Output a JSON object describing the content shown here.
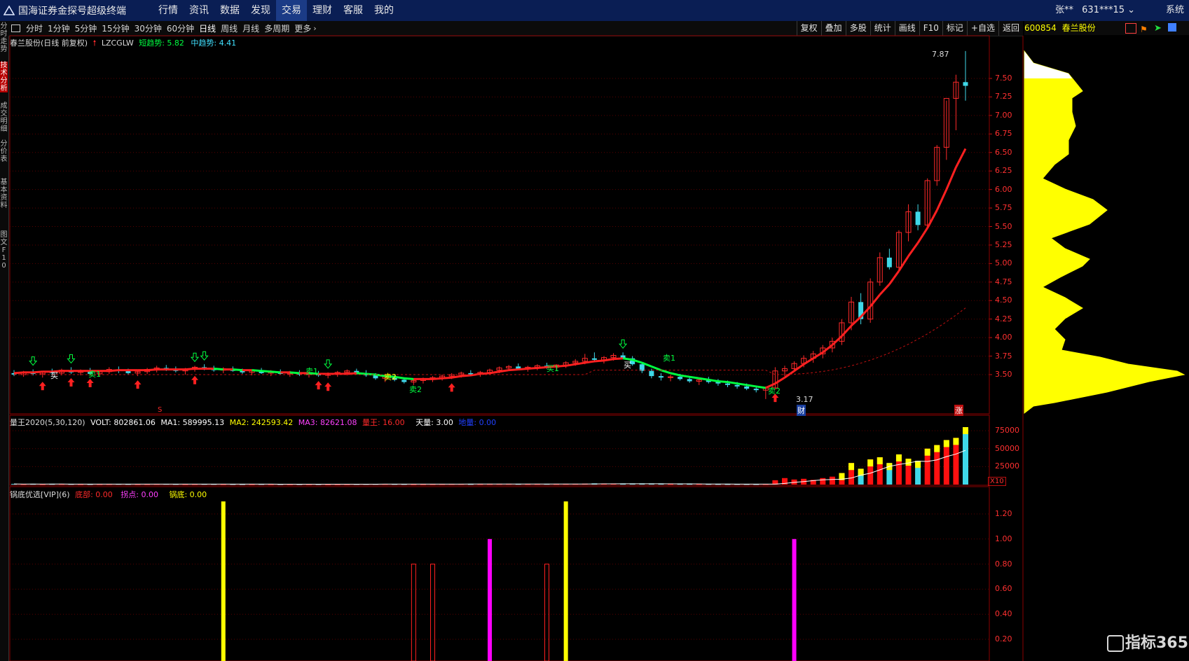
{
  "app": {
    "title": "国海证券金探号超级终端"
  },
  "menu": [
    "行情",
    "资讯",
    "数据",
    "发现",
    "交易",
    "理财",
    "客服",
    "我的"
  ],
  "menu_active": 4,
  "user": {
    "name": "张**",
    "account": "631***15"
  },
  "system_label": "系统",
  "periods": [
    "分时",
    "1分钟",
    "5分钟",
    "15分钟",
    "30分钟",
    "60分钟",
    "日线",
    "周线",
    "月线",
    "多周期",
    "更多"
  ],
  "period_active": 6,
  "right_buttons": [
    "复权",
    "叠加",
    "多股",
    "统计",
    "画线",
    "F10",
    "标记",
    "+自选",
    "返回"
  ],
  "left_tabs": [
    "分时走势",
    "技术分析",
    "成交明细",
    "分价表",
    "基本资料",
    "图文F10"
  ],
  "main_header": {
    "stock": "春兰股份(日线 前复权)",
    "indicator": "LZCGLW",
    "short_label": "短趋势",
    "short_val": "5.82",
    "mid_label": "中趋势",
    "mid_val": "4.41"
  },
  "annotations": {
    "high": "7.87",
    "low": "3.17",
    "cai": "财",
    "zhang": "涨",
    "s_mark": "S",
    "buy": "买",
    "sell1": "卖1",
    "sell2": "卖2",
    "buy1": "买1"
  },
  "price_axis": [
    "7.50",
    "7.25",
    "7.00",
    "6.75",
    "6.50",
    "6.25",
    "6.00",
    "5.75",
    "5.50",
    "5.25",
    "5.00",
    "4.75",
    "4.50",
    "4.25",
    "4.00",
    "3.75",
    "3.50"
  ],
  "vol_header": {
    "name": "量王2020(5,30,120)",
    "volt": "VOLT: 802861.06",
    "ma1": "MA1: 589995.13",
    "ma2": "MA2: 242593.42",
    "ma3": "MA3: 82621.08",
    "lw": "量王: 16.00",
    "tl": "天量: 3.00",
    "ll": "地量: 0.00"
  },
  "vol_axis": [
    "75000",
    "50000",
    "25000"
  ],
  "vol_unit": "X10",
  "ind_header": {
    "name": "锅底优选[VIP](6)",
    "db": "底部: 0.00",
    "gd": "拐点: 0.00",
    "gdi": "锅底: 0.00"
  },
  "ind_axis": [
    "1.20",
    "1.00",
    "0.80",
    "0.60",
    "0.40",
    "0.20"
  ],
  "right_panel": {
    "code": "600854",
    "name": "春兰股份"
  },
  "watermark": "指标365",
  "colors": {
    "up": "#ff2a2a",
    "down": "#3fd8e8",
    "short_trend": "#00ff40",
    "yellow": "#ffff00",
    "magenta": "#ff00ff",
    "axis": "#c01010"
  },
  "chart_data": [
    {
      "type": "candlestick",
      "title": "春兰股份(日线 前复权)",
      "ylim": [
        3.2,
        7.9
      ],
      "candles": [
        [
          3.52,
          3.56,
          3.48,
          3.5
        ],
        [
          3.5,
          3.55,
          3.47,
          3.53
        ],
        [
          3.53,
          3.57,
          3.49,
          3.51
        ],
        [
          3.51,
          3.55,
          3.46,
          3.54
        ],
        [
          3.54,
          3.58,
          3.5,
          3.52
        ],
        [
          3.52,
          3.58,
          3.49,
          3.56
        ],
        [
          3.56,
          3.6,
          3.51,
          3.53
        ],
        [
          3.53,
          3.57,
          3.49,
          3.55
        ],
        [
          3.55,
          3.59,
          3.5,
          3.51
        ],
        [
          3.51,
          3.56,
          3.48,
          3.54
        ],
        [
          3.54,
          3.6,
          3.51,
          3.57
        ],
        [
          3.57,
          3.61,
          3.52,
          3.55
        ],
        [
          3.55,
          3.58,
          3.5,
          3.52
        ],
        [
          3.52,
          3.56,
          3.48,
          3.54
        ],
        [
          3.54,
          3.59,
          3.51,
          3.57
        ],
        [
          3.57,
          3.62,
          3.53,
          3.59
        ],
        [
          3.59,
          3.63,
          3.55,
          3.58
        ],
        [
          3.58,
          3.61,
          3.53,
          3.55
        ],
        [
          3.55,
          3.59,
          3.5,
          3.57
        ],
        [
          3.57,
          3.62,
          3.54,
          3.6
        ],
        [
          3.6,
          3.64,
          3.56,
          3.58
        ],
        [
          3.58,
          3.62,
          3.54,
          3.56
        ],
        [
          3.56,
          3.6,
          3.52,
          3.58
        ],
        [
          3.58,
          3.61,
          3.54,
          3.55
        ],
        [
          3.55,
          3.58,
          3.51,
          3.53
        ],
        [
          3.53,
          3.57,
          3.49,
          3.55
        ],
        [
          3.55,
          3.59,
          3.51,
          3.52
        ],
        [
          3.52,
          3.56,
          3.48,
          3.54
        ],
        [
          3.54,
          3.57,
          3.5,
          3.51
        ],
        [
          3.51,
          3.55,
          3.47,
          3.53
        ],
        [
          3.53,
          3.56,
          3.48,
          3.5
        ],
        [
          3.5,
          3.54,
          3.46,
          3.52
        ],
        [
          3.52,
          3.55,
          3.47,
          3.49
        ],
        [
          3.49,
          3.53,
          3.45,
          3.51
        ],
        [
          3.51,
          3.55,
          3.47,
          3.53
        ],
        [
          3.53,
          3.57,
          3.49,
          3.55
        ],
        [
          3.55,
          3.58,
          3.5,
          3.52
        ],
        [
          3.52,
          3.56,
          3.47,
          3.49
        ],
        [
          3.49,
          3.52,
          3.43,
          3.45
        ],
        [
          3.45,
          3.49,
          3.4,
          3.47
        ],
        [
          3.47,
          3.5,
          3.41,
          3.43
        ],
        [
          3.43,
          3.46,
          3.38,
          3.4
        ],
        [
          3.4,
          3.44,
          3.36,
          3.42
        ],
        [
          3.42,
          3.46,
          3.38,
          3.44
        ],
        [
          3.44,
          3.48,
          3.4,
          3.46
        ],
        [
          3.46,
          3.5,
          3.42,
          3.48
        ],
        [
          3.48,
          3.52,
          3.44,
          3.5
        ],
        [
          3.5,
          3.54,
          3.46,
          3.52
        ],
        [
          3.52,
          3.56,
          3.48,
          3.5
        ],
        [
          3.5,
          3.55,
          3.47,
          3.53
        ],
        [
          3.53,
          3.58,
          3.5,
          3.56
        ],
        [
          3.56,
          3.61,
          3.52,
          3.59
        ],
        [
          3.59,
          3.63,
          3.55,
          3.61
        ],
        [
          3.61,
          3.65,
          3.57,
          3.58
        ],
        [
          3.58,
          3.62,
          3.54,
          3.6
        ],
        [
          3.6,
          3.64,
          3.56,
          3.62
        ],
        [
          3.62,
          3.66,
          3.58,
          3.6
        ],
        [
          3.6,
          3.64,
          3.56,
          3.63
        ],
        [
          3.63,
          3.68,
          3.59,
          3.66
        ],
        [
          3.66,
          3.71,
          3.62,
          3.68
        ],
        [
          3.68,
          3.78,
          3.64,
          3.72
        ],
        [
          3.72,
          3.8,
          3.67,
          3.7
        ],
        [
          3.7,
          3.75,
          3.65,
          3.73
        ],
        [
          3.73,
          3.79,
          3.69,
          3.76
        ],
        [
          3.76,
          3.8,
          3.71,
          3.72
        ],
        [
          3.72,
          3.75,
          3.62,
          3.64
        ],
        [
          3.64,
          3.66,
          3.52,
          3.55
        ],
        [
          3.55,
          3.58,
          3.45,
          3.48
        ],
        [
          3.48,
          3.52,
          3.42,
          3.46
        ],
        [
          3.46,
          3.5,
          3.41,
          3.47
        ],
        [
          3.47,
          3.51,
          3.42,
          3.44
        ],
        [
          3.44,
          3.48,
          3.39,
          3.41
        ],
        [
          3.41,
          3.45,
          3.36,
          3.43
        ],
        [
          3.43,
          3.47,
          3.38,
          3.4
        ],
        [
          3.4,
          3.44,
          3.35,
          3.38
        ],
        [
          3.38,
          3.42,
          3.33,
          3.36
        ],
        [
          3.36,
          3.4,
          3.31,
          3.34
        ],
        [
          3.34,
          3.38,
          3.29,
          3.31
        ],
        [
          3.31,
          3.35,
          3.26,
          3.29
        ],
        [
          3.29,
          3.34,
          3.17,
          3.32
        ],
        [
          3.32,
          3.6,
          3.3,
          3.55
        ],
        [
          3.55,
          3.62,
          3.48,
          3.58
        ],
        [
          3.58,
          3.68,
          3.54,
          3.65
        ],
        [
          3.65,
          3.76,
          3.6,
          3.72
        ],
        [
          3.72,
          3.82,
          3.66,
          3.78
        ],
        [
          3.78,
          3.9,
          3.72,
          3.86
        ],
        [
          3.86,
          4.0,
          3.8,
          3.95
        ],
        [
          3.95,
          4.25,
          3.9,
          4.2
        ],
        [
          4.2,
          4.55,
          4.1,
          4.48
        ],
        [
          4.48,
          4.6,
          4.18,
          4.25
        ],
        [
          4.25,
          4.8,
          4.2,
          4.75
        ],
        [
          4.75,
          5.15,
          4.7,
          5.08
        ],
        [
          5.08,
          5.2,
          4.92,
          4.95
        ],
        [
          4.95,
          5.45,
          4.9,
          5.42
        ],
        [
          5.42,
          5.8,
          5.3,
          5.7
        ],
        [
          5.7,
          5.8,
          5.45,
          5.52
        ],
        [
          5.52,
          6.15,
          5.48,
          6.12
        ],
        [
          6.12,
          6.6,
          6.05,
          6.57
        ],
        [
          6.57,
          7.2,
          6.4,
          7.23
        ],
        [
          7.23,
          7.55,
          6.8,
          7.45
        ],
        [
          7.45,
          7.87,
          7.2,
          7.4
        ]
      ],
      "ma_short": [
        3.52,
        3.53,
        3.53,
        3.54,
        3.54,
        3.55,
        3.55,
        3.55,
        3.55,
        3.55,
        3.55,
        3.56,
        3.56,
        3.56,
        3.56,
        3.57,
        3.57,
        3.57,
        3.57,
        3.58,
        3.58,
        3.58,
        3.57,
        3.57,
        3.56,
        3.56,
        3.55,
        3.54,
        3.53,
        3.53,
        3.52,
        3.52,
        3.51,
        3.51,
        3.51,
        3.51,
        3.52,
        3.51,
        3.5,
        3.48,
        3.47,
        3.45,
        3.44,
        3.44,
        3.44,
        3.45,
        3.46,
        3.48,
        3.49,
        3.51,
        3.52,
        3.54,
        3.56,
        3.57,
        3.58,
        3.59,
        3.6,
        3.61,
        3.62,
        3.64,
        3.66,
        3.68,
        3.69,
        3.71,
        3.72,
        3.7,
        3.66,
        3.61,
        3.56,
        3.52,
        3.49,
        3.47,
        3.45,
        3.43,
        3.41,
        3.4,
        3.38,
        3.36,
        3.34,
        3.32,
        3.38,
        3.46,
        3.55,
        3.64,
        3.72,
        3.8,
        3.9,
        4.02,
        4.16,
        4.28,
        4.42,
        4.58,
        4.72,
        4.9,
        5.1,
        5.28,
        5.48,
        5.72,
        6.0,
        6.3,
        6.55
      ]
    },
    {
      "type": "bar",
      "title": "量王2020(5,30,120)",
      "ylim": [
        0,
        80000
      ],
      "values": [
        900,
        700,
        800,
        650,
        750,
        800,
        700,
        650,
        600,
        700,
        750,
        800,
        700,
        650,
        700,
        800,
        850,
        700,
        650,
        700,
        750,
        700,
        650,
        600,
        550,
        600,
        650,
        600,
        550,
        600,
        550,
        600,
        550,
        500,
        550,
        600,
        650,
        700,
        750,
        800,
        700,
        650,
        600,
        650,
        700,
        750,
        800,
        850,
        700,
        750,
        800,
        850,
        900,
        800,
        750,
        800,
        850,
        800,
        850,
        900,
        1200,
        1600,
        1100,
        1000,
        900,
        1300,
        1500,
        1100,
        900,
        800,
        850,
        800,
        750,
        700,
        650,
        600,
        650,
        600,
        550,
        700,
        6000,
        9000,
        7000,
        8000,
        6500,
        9000,
        11000,
        16000,
        30000,
        22000,
        35000,
        38000,
        30000,
        42000,
        36000,
        33000,
        50000,
        55000,
        62000,
        65000,
        80000
      ]
    },
    {
      "type": "bar",
      "title": "锅底优选[VIP](6)",
      "ylim": [
        0,
        1.4
      ],
      "series": [
        {
          "name": "锅底",
          "points": [
            [
              22,
              1.3
            ],
            [
              58,
              1.3
            ]
          ]
        },
        {
          "name": "拐点",
          "points": [
            [
              50,
              1.0
            ],
            [
              82,
              1.0
            ]
          ]
        },
        {
          "name": "底部",
          "points": [
            [
              42,
              0.8
            ],
            [
              44,
              0.8
            ],
            [
              56,
              0.8
            ]
          ]
        }
      ]
    }
  ]
}
